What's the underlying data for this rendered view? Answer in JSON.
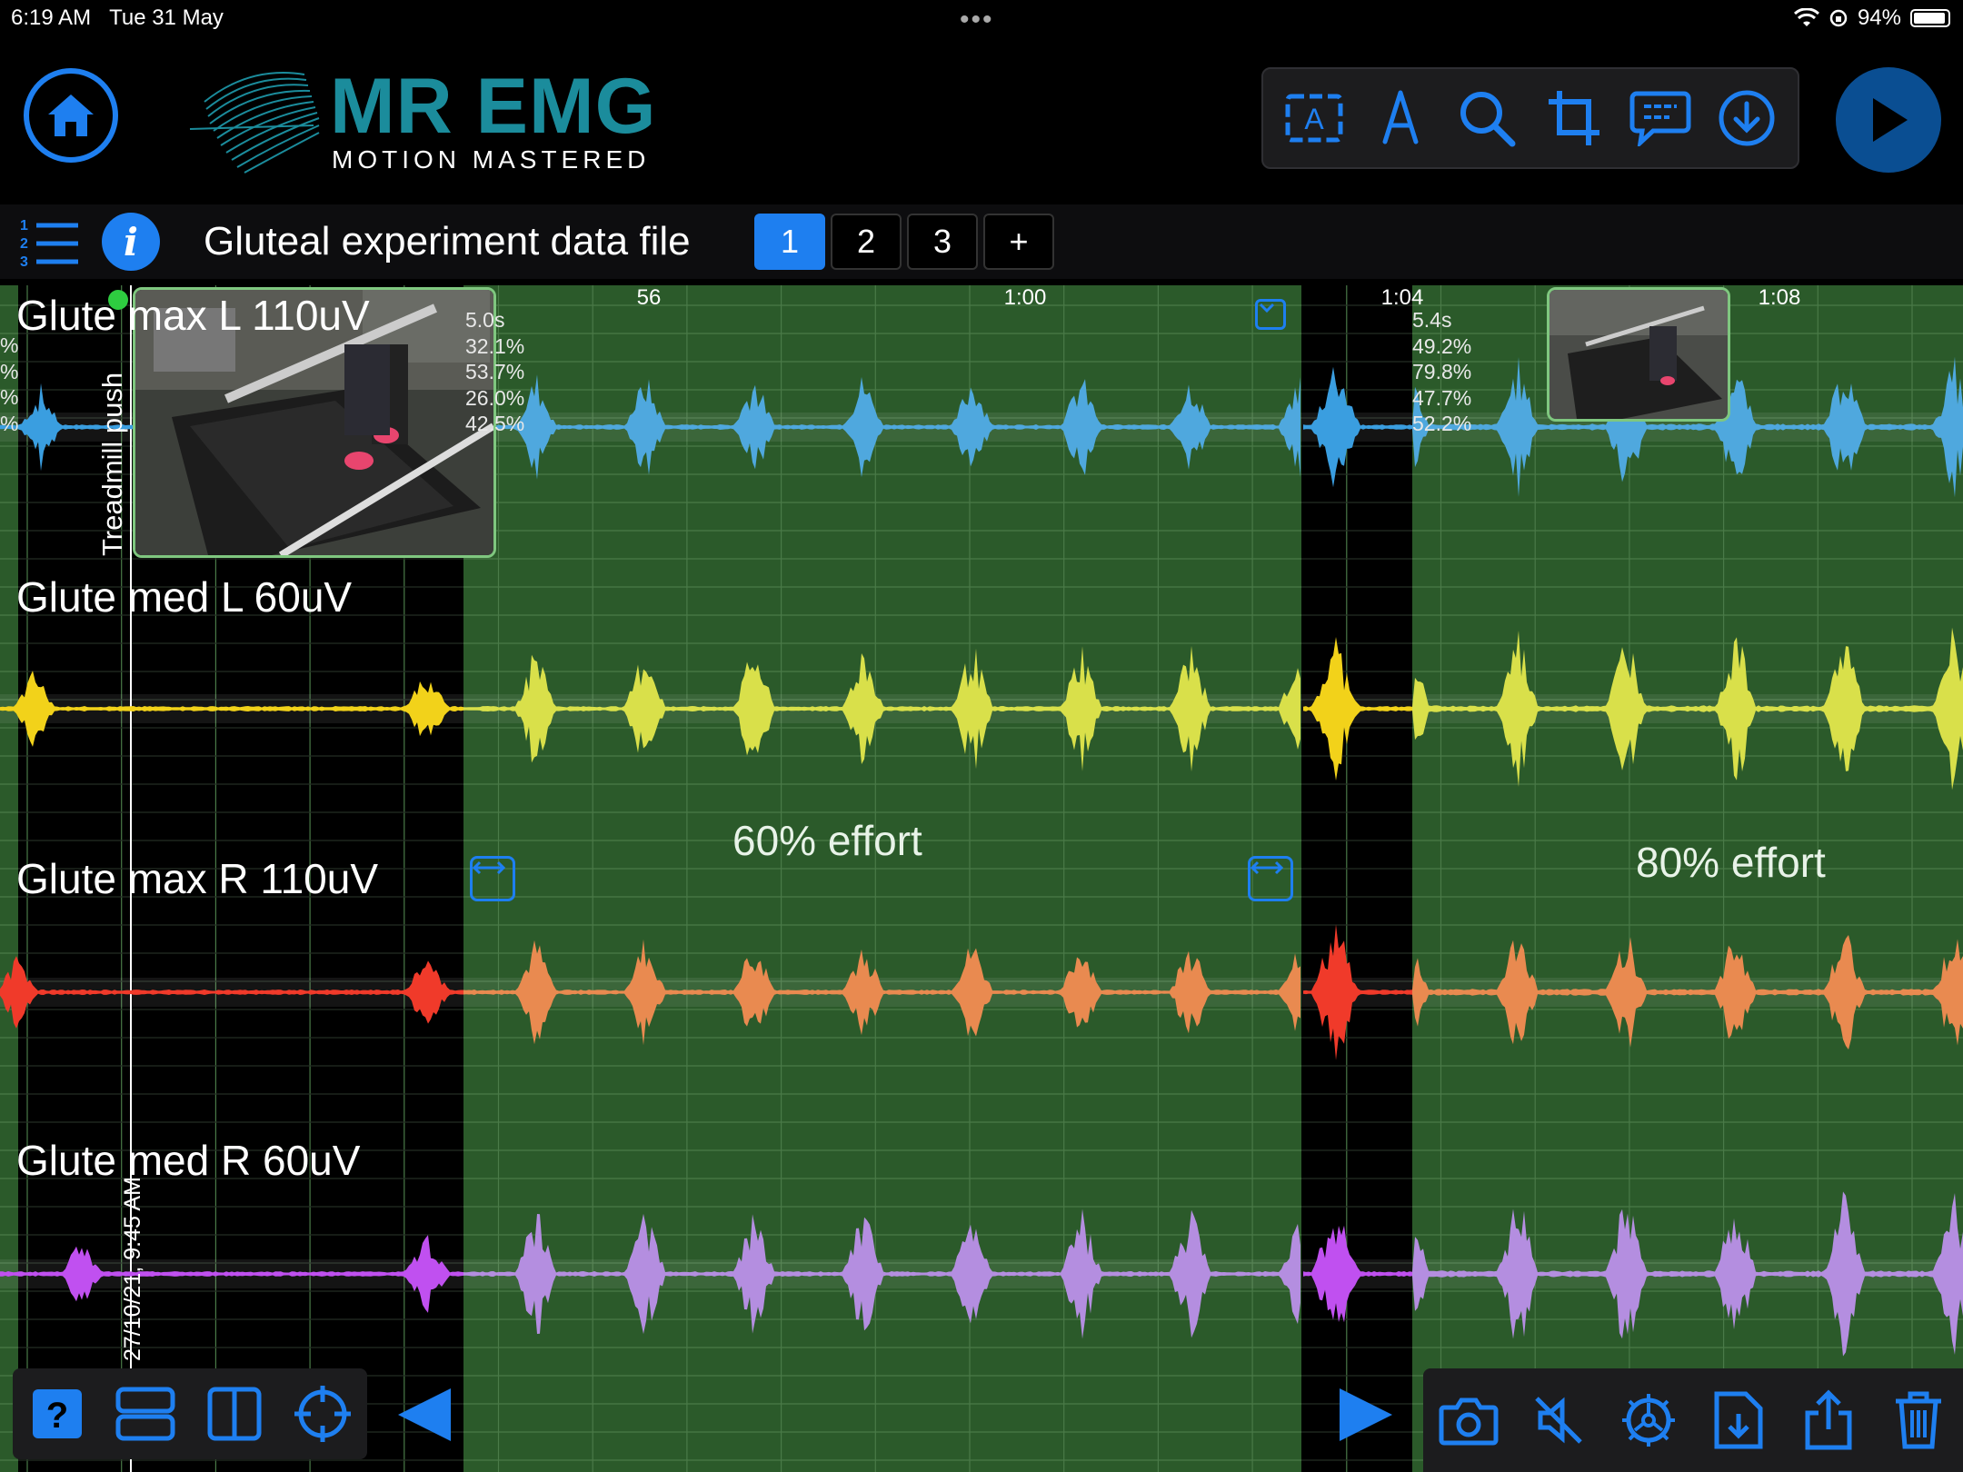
{
  "status_bar": {
    "time": "6:19 AM",
    "date": "Tue 31 May",
    "battery": "94%",
    "battery_level": 0.94
  },
  "header": {
    "logo_title": "MR EMG",
    "logo_tagline": "MOTION MASTERED",
    "tools": [
      "text-box-icon",
      "pen-icon",
      "search-icon",
      "crop-icon",
      "comment-icon",
      "download-icon"
    ]
  },
  "file": {
    "title": "Gluteal experiment data file",
    "pages": [
      "1",
      "2",
      "3",
      "+"
    ],
    "active_page": "1"
  },
  "colors": {
    "accent": "#1e7ff0",
    "grid_green": "#2a5a2a",
    "ch1": "#3a9ee0",
    "ch2": "#f2d21a",
    "ch3": "#f05a2a",
    "ch4": "#c060f0"
  },
  "chart": {
    "time_ticks": [
      "56",
      "1:00",
      "1:04",
      "1:08"
    ],
    "channels": [
      {
        "label": "Glute max L 110uV",
        "color": "#3a9ee0",
        "muted": "#4fa8de"
      },
      {
        "label": "Glute med L 60uV",
        "color": "#f2d21a",
        "muted": "#d9e04a"
      },
      {
        "label": "Glute max R 110uV",
        "color": "#f03a2a",
        "muted": "#e98a50"
      },
      {
        "label": "Glute med R 60uV",
        "color": "#c050f0",
        "muted": "#b48ee0"
      }
    ],
    "segments": [
      {
        "label": "60% effort",
        "duration": "5.0s",
        "stats": [
          "32.1%",
          "53.7%",
          "26.0%",
          "42.5%"
        ]
      },
      {
        "label": "80% effort",
        "duration": "5.4s",
        "stats": [
          "49.2%",
          "79.8%",
          "47.7%",
          "52.2%"
        ]
      }
    ],
    "left_partial_stats": [
      "%",
      "%",
      "%",
      "%"
    ],
    "marker_label": "Treadmill push",
    "timestamp_label": "27/10/21, 9:45 AM"
  }
}
